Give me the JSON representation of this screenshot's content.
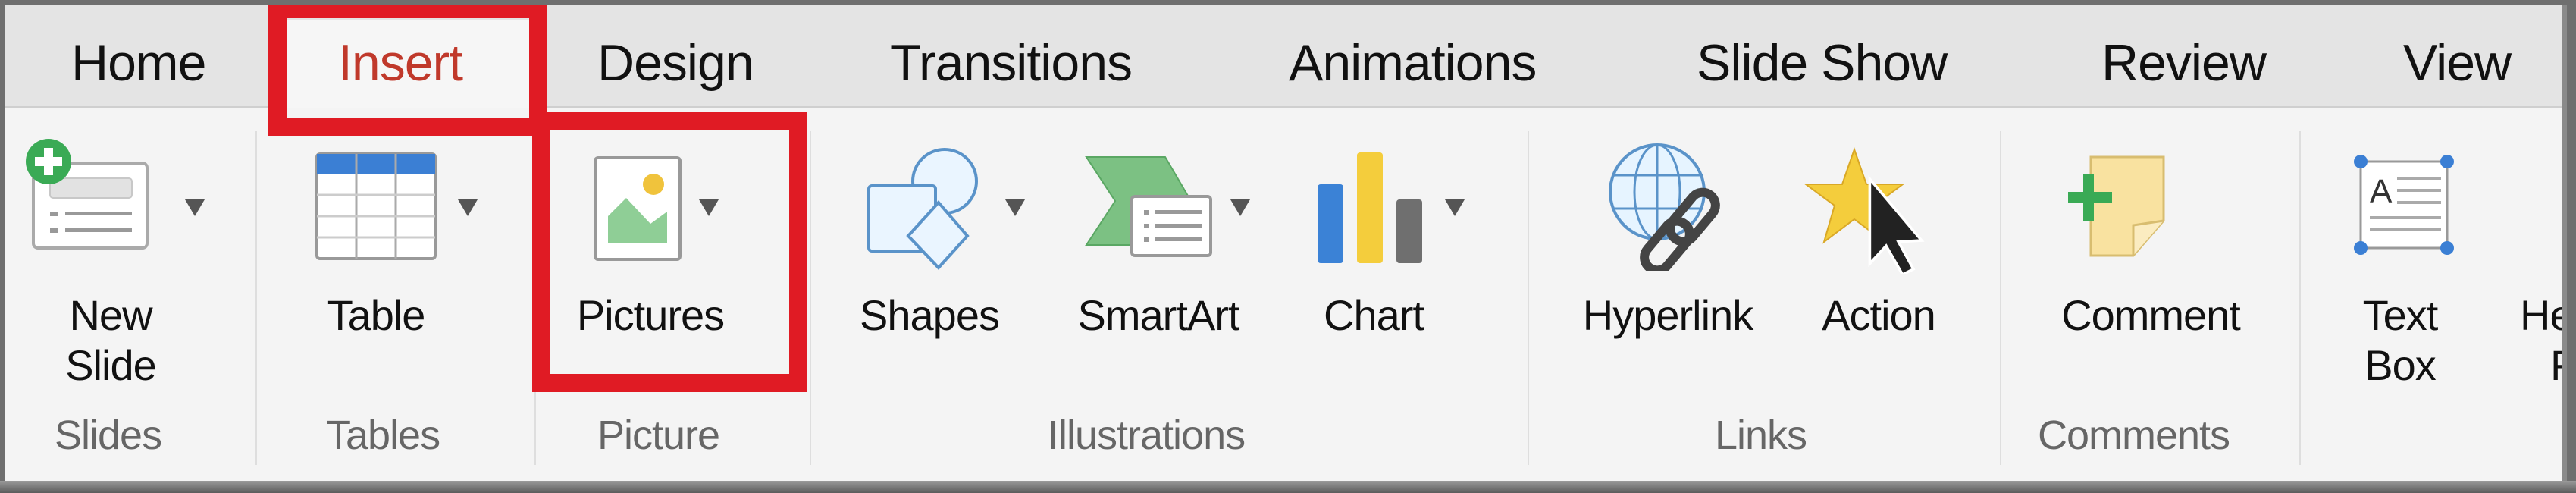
{
  "tabs": [
    {
      "label": "Home",
      "active": false
    },
    {
      "label": "Insert",
      "active": true
    },
    {
      "label": "Design",
      "active": false
    },
    {
      "label": "Transitions",
      "active": false
    },
    {
      "label": "Animations",
      "active": false
    },
    {
      "label": "Slide Show",
      "active": false
    },
    {
      "label": "Review",
      "active": false
    },
    {
      "label": "View",
      "active": false
    }
  ],
  "groups": {
    "slides": {
      "label": "Slides",
      "new_slide": {
        "line1": "New",
        "line2": "Slide",
        "icon": "new-slide-icon"
      }
    },
    "tables": {
      "label": "Tables",
      "table": {
        "label": "Table",
        "icon": "table-icon"
      }
    },
    "picture": {
      "label": "Picture",
      "pictures": {
        "label": "Pictures",
        "icon": "picture-icon"
      }
    },
    "illustrations": {
      "label": "Illustrations",
      "shapes": {
        "label": "Shapes",
        "icon": "shapes-icon"
      },
      "smartart": {
        "label": "SmartArt",
        "icon": "smartart-icon"
      },
      "chart": {
        "label": "Chart",
        "icon": "chart-icon"
      }
    },
    "links": {
      "label": "Links",
      "hyperlink": {
        "label": "Hyperlink",
        "icon": "hyperlink-icon"
      },
      "action": {
        "label": "Action",
        "icon": "action-icon"
      }
    },
    "comments": {
      "label": "Comments",
      "comment": {
        "label": "Comment",
        "icon": "comment-icon"
      }
    },
    "text": {
      "text_box": {
        "line1": "Text",
        "line2": "Box",
        "icon": "text-box-icon"
      },
      "header_footer_partial": {
        "line1": "He",
        "line2": "F"
      }
    }
  },
  "highlights": [
    "Insert tab",
    "Pictures button"
  ],
  "colors": {
    "highlight": "#e01b24",
    "active_tab_text": "#c0392b",
    "accent_blue": "#3b7fd4",
    "accent_green": "#3aaa55",
    "accent_yellow": "#f4c842"
  }
}
